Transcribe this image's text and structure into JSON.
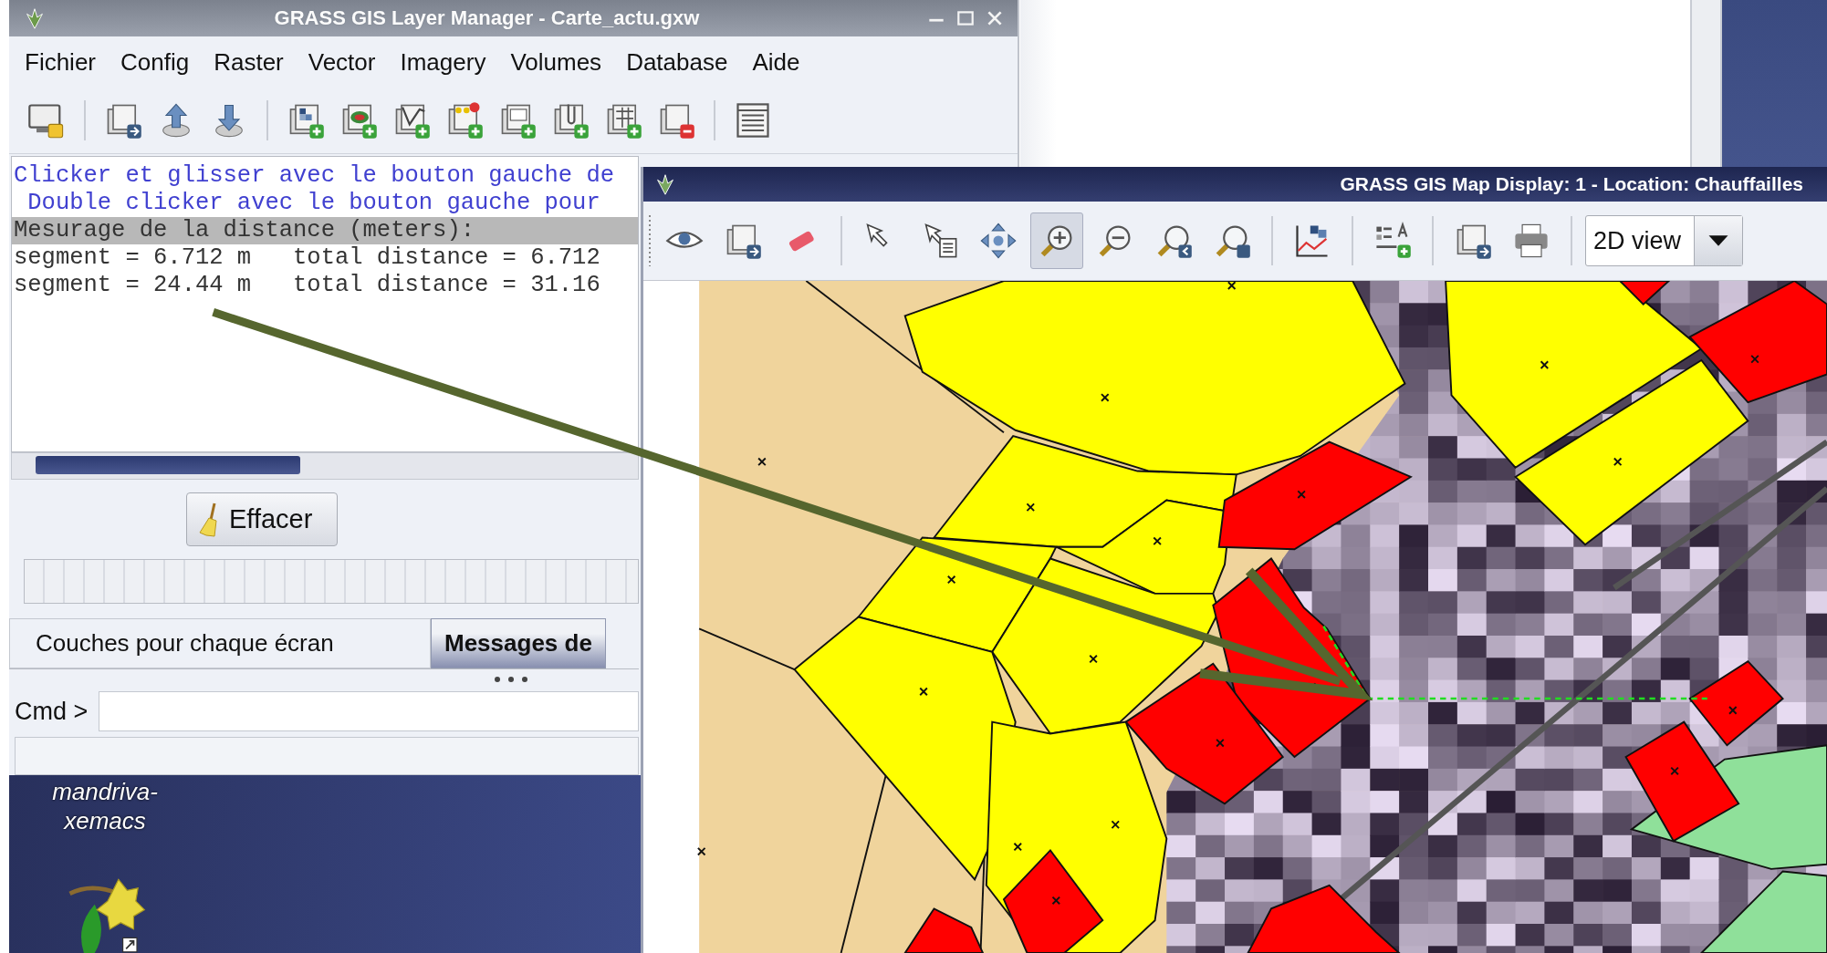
{
  "layer_manager": {
    "title": "GRASS GIS Layer Manager - Carte_actu.gxw",
    "menu": [
      "Fichier",
      "Config",
      "Raster",
      "Vector",
      "Imagery",
      "Volumes",
      "Database",
      "Aide"
    ],
    "console_lines": [
      {
        "kind": "hint",
        "text": "Clicker et glisser avec le bouton gauche de"
      },
      {
        "kind": "hint",
        "text": " Double clicker avec le bouton gauche pour"
      },
      {
        "kind": "heading",
        "text": "Mesurage de la distance (meters):"
      },
      {
        "kind": "output",
        "text": "segment = 6.712 m   total distance = 6.712"
      },
      {
        "kind": "output",
        "text": "segment = 24.44 m   total distance = 31.16"
      }
    ],
    "clear_button": "Effacer",
    "progress": {
      "level": 0
    },
    "tabs": [
      {
        "label": "Couches pour chaque écran",
        "selected": false
      },
      {
        "label": "Messages de",
        "selected": true
      }
    ],
    "cmd_label": "Cmd >"
  },
  "map_display": {
    "title": "GRASS GIS Map Display: 1 - Location: Chauffailles",
    "tools": [
      {
        "selected": false
      },
      {
        "selected": false
      },
      {
        "selected": false
      },
      {
        "selected": false
      },
      {
        "selected": false
      },
      {
        "selected": false
      },
      {
        "selected": true
      },
      {
        "selected": false
      },
      {
        "selected": false
      },
      {
        "selected": false
      },
      {
        "selected": false
      },
      {
        "selected": false
      },
      {
        "selected": false
      },
      {
        "selected": false
      }
    ],
    "view_select": "2D view"
  },
  "desktop": {
    "icon_label": "mandriva-xemacs"
  }
}
